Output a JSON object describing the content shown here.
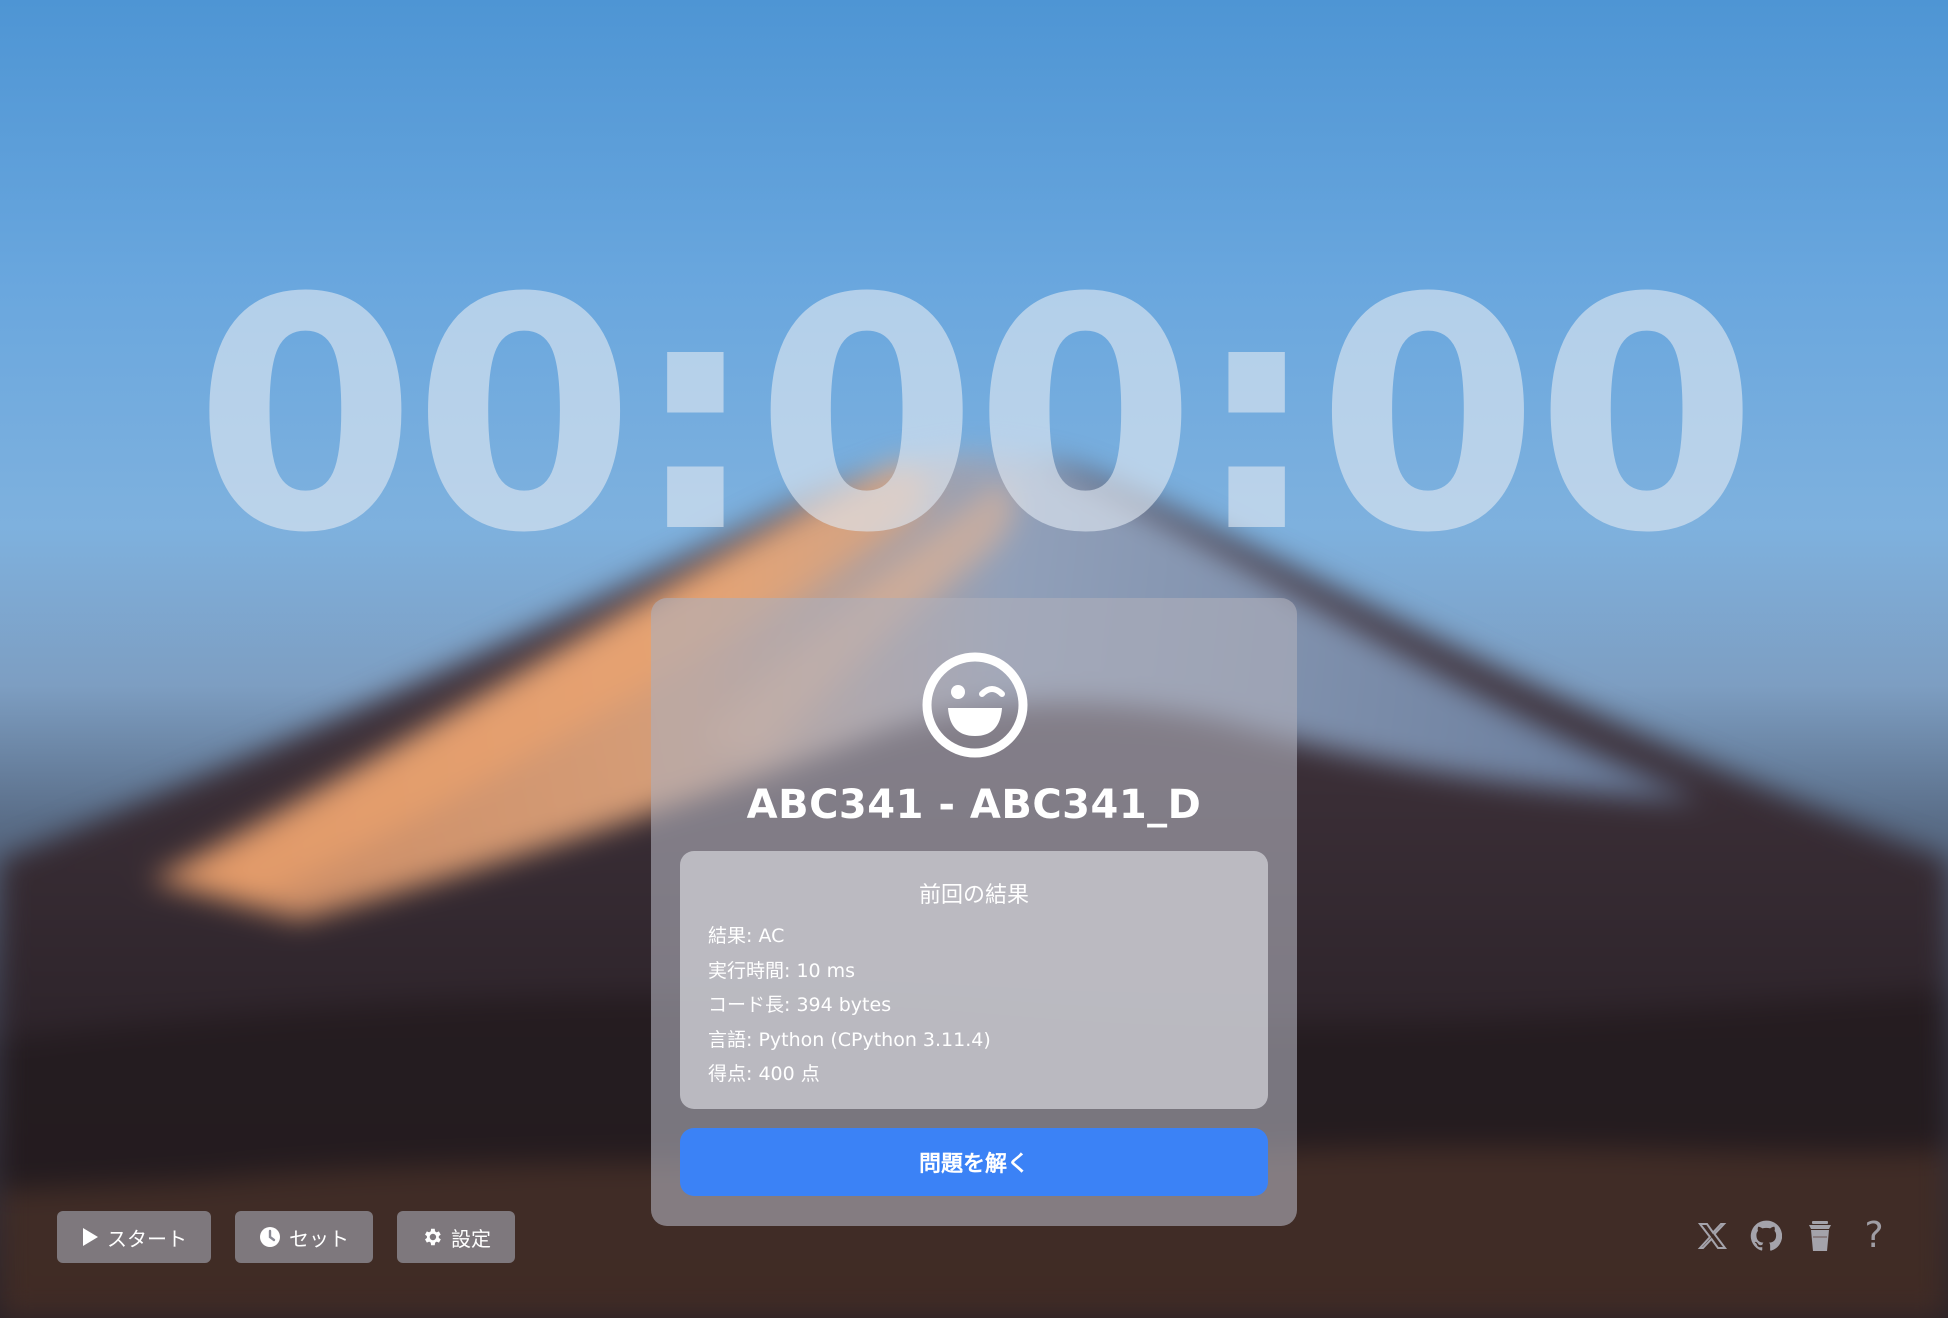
{
  "timer": {
    "display": "00:00:00"
  },
  "card": {
    "icon": "wink-face-icon",
    "title": "ABC341 - ABC341_D",
    "previous_result": {
      "heading": "前回の結果",
      "lines": [
        "結果: AC",
        "実行時間: 10 ms",
        "コード長: 394 bytes",
        "言語: Python (CPython 3.11.4)",
        "得点: 400 点"
      ]
    },
    "solve_button_label": "問題を解く",
    "accent_color": "#3b82f6"
  },
  "controls": {
    "start_label": "スタート",
    "set_label": "セット",
    "settings_label": "設定"
  },
  "footer_icons": [
    "x-icon",
    "github-icon",
    "coffee-cup-icon",
    "help-icon"
  ],
  "help_glyph": "?"
}
